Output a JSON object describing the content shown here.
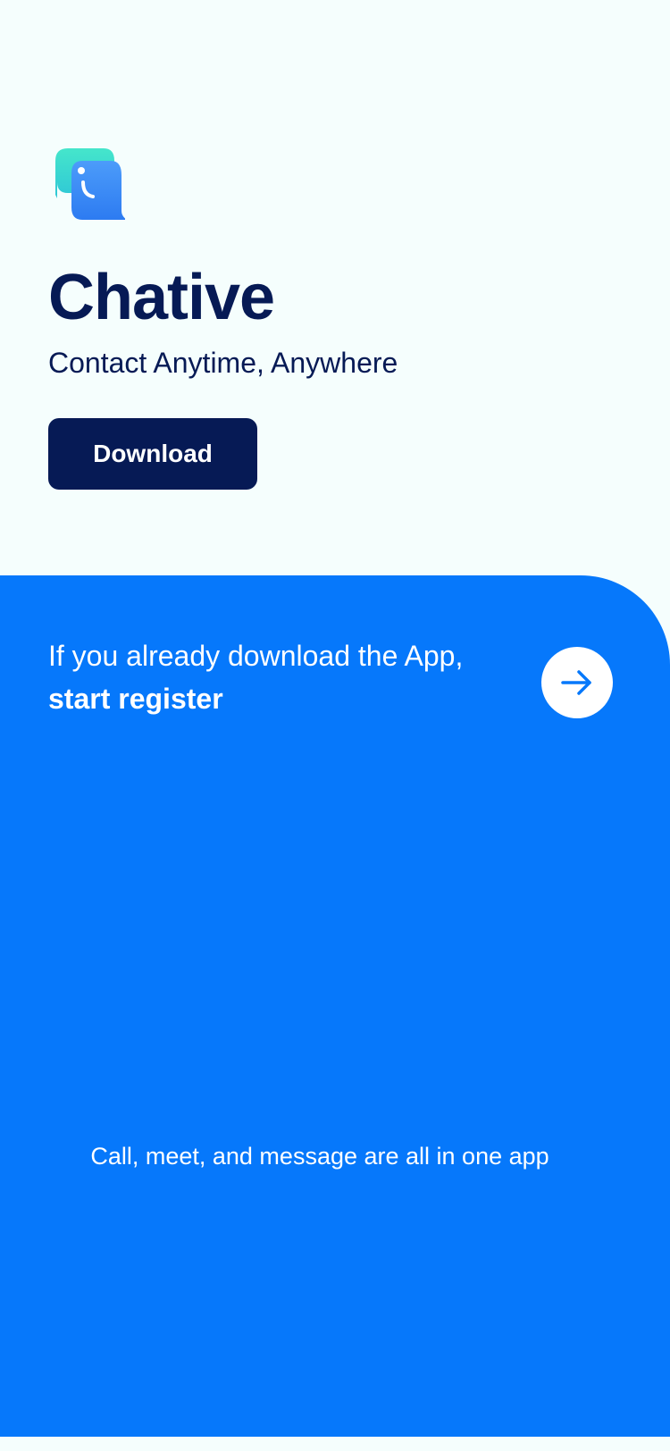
{
  "brand": {
    "name": "Chative",
    "tagline": "Contact Anytime, Anywhere",
    "logo_icon": "chat-bubble-logo-icon"
  },
  "actions": {
    "download_label": "Download"
  },
  "register": {
    "lead_text": "If you already download the App,",
    "strong_text": "start register",
    "arrow_icon": "arrow-right-icon"
  },
  "footer": {
    "text": "Call, meet, and message are all in one app"
  },
  "colors": {
    "navy": "#061A55",
    "primary_blue": "#0678FB",
    "background": "#F5FEFD",
    "logo_teal": "#3CE0C8",
    "logo_blue": "#3F8CF8"
  }
}
